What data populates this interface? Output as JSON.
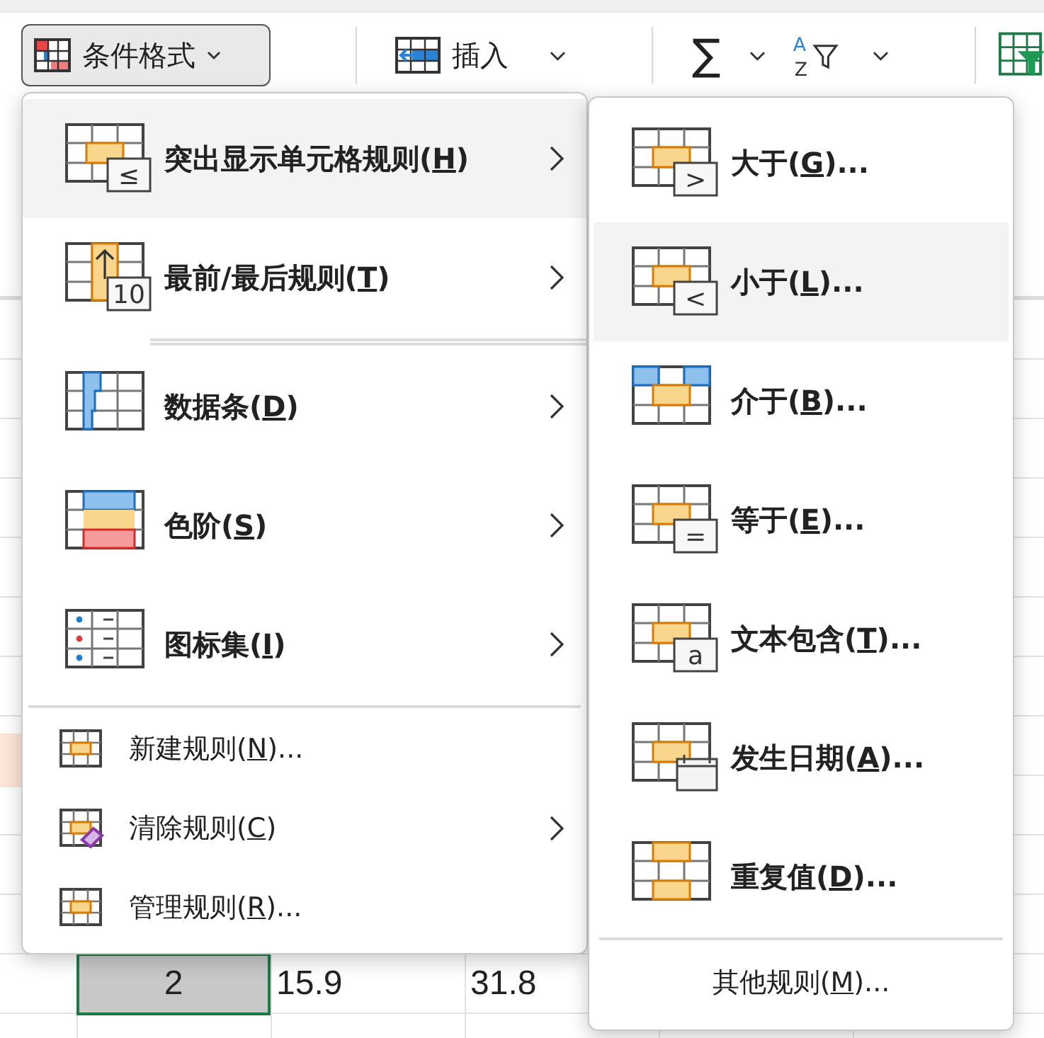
{
  "ribbon": [
    {
      "kind": "format",
      "label": "条件格式",
      "expanded": true
    },
    {
      "kind": "insert",
      "label": "插入"
    },
    {
      "kind": "sum",
      "glyph": "∑"
    },
    {
      "kind": "sort",
      "letters": [
        "A",
        "Z"
      ]
    },
    {
      "kind": "table"
    }
  ],
  "menu": {
    "items": [
      {
        "kind": "category",
        "label": "突出显示单元格规则(",
        "access_key": "H",
        "label_end": ")",
        "badge": "≤",
        "submenu": true,
        "selected": true
      },
      {
        "kind": "category",
        "label": "最前/最后规则(",
        "access_key": "T",
        "label_end": ")",
        "badge": "10",
        "submenu": true,
        "selected": false
      },
      {
        "kind": "category",
        "label": "数据条(",
        "access_key": "D",
        "label_end": ")",
        "submenu": true,
        "selected": false
      },
      {
        "kind": "category",
        "label": "色阶(",
        "access_key": "S",
        "label_end": ")",
        "submenu": true,
        "selected": false
      },
      {
        "kind": "category",
        "label": "图标集(",
        "access_key": "I",
        "label_end": ")",
        "submenu": true,
        "selected": false
      },
      {
        "kind": "action",
        "label": "新建规则(",
        "access_key": "N",
        "label_end": ")...",
        "submenu": false,
        "selected": false
      },
      {
        "kind": "action",
        "label": "清除规则(",
        "access_key": "C",
        "label_end": ")",
        "submenu": true,
        "selected": false
      },
      {
        "kind": "action",
        "label": "管理规则(",
        "access_key": "R",
        "label_end": ")...",
        "submenu": false,
        "selected": false
      }
    ]
  },
  "submenu": {
    "items": [
      {
        "kind": "rule",
        "label": "大于(",
        "access_key": "G",
        "label_end": ")...",
        "badge": ">",
        "selected": false
      },
      {
        "kind": "rule",
        "label": "小于(",
        "access_key": "L",
        "label_end": ")...",
        "badge": "<",
        "selected": true
      },
      {
        "kind": "rule",
        "label": "介于(",
        "access_key": "B",
        "label_end": ")...",
        "selected": false
      },
      {
        "kind": "rule",
        "label": "等于(",
        "access_key": "E",
        "label_end": ")...",
        "badge": "=",
        "selected": false
      },
      {
        "kind": "rule",
        "label": "文本包含(",
        "access_key": "T",
        "label_end": ")...",
        "badge": "a",
        "selected": false
      },
      {
        "kind": "rule",
        "label": "发生日期(",
        "access_key": "A",
        "label_end": ")...",
        "selected": false
      },
      {
        "kind": "rule",
        "label": "重复值(",
        "access_key": "D",
        "label_end": ")...",
        "selected": false
      },
      {
        "kind": "more",
        "label": "其他规则(",
        "access_key": "M",
        "label_end": ")...",
        "selected": false
      }
    ]
  },
  "sheet": {
    "cells": [
      {
        "text": "2",
        "selected": true
      },
      {
        "text": "15.9",
        "selected": false
      },
      {
        "text": "31.8",
        "selected": false
      }
    ]
  }
}
